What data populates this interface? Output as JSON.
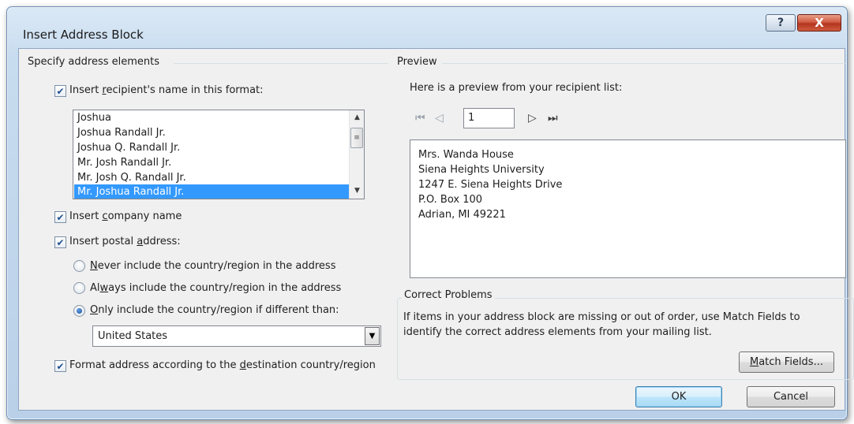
{
  "window": {
    "title": "Insert Address Block",
    "help_glyph": "?",
    "close_glyph": "X"
  },
  "left": {
    "group_title": "Specify address elements",
    "name_format": {
      "checked": true,
      "label_before": "Insert ",
      "label_accel": "r",
      "label_after": "ecipient's name in this format:",
      "items": [
        "Joshua",
        "Joshua Randall Jr.",
        "Joshua Q. Randall Jr.",
        "Mr. Josh Randall Jr.",
        "Mr. Josh Q. Randall Jr.",
        "Mr. Joshua Randall Jr."
      ],
      "selected_index": 5
    },
    "company": {
      "checked": true,
      "label_before": "Insert ",
      "label_accel": "c",
      "label_after": "ompany name"
    },
    "postal": {
      "checked": true,
      "label_before": "Insert postal ",
      "label_accel": "a",
      "label_after": "ddress:",
      "options": [
        {
          "before": "",
          "accel": "N",
          "after": "ever include the country/region in the address",
          "selected": false
        },
        {
          "before": "Al",
          "accel": "w",
          "after": "ays include the country/region in the address",
          "selected": false
        },
        {
          "before": "",
          "accel": "O",
          "after": "nly include the country/region if different than:",
          "selected": true
        }
      ],
      "country_value": "United States"
    },
    "format_by_destination": {
      "checked": true,
      "label_before": "Format address according to the ",
      "label_accel": "d",
      "label_after": "estination country/region"
    }
  },
  "right": {
    "preview_title": "Preview",
    "preview_intro": "Here is a preview from your recipient list:",
    "record_number": "1",
    "preview_lines": [
      "Mrs. Wanda House",
      "Siena Heights University",
      "1247 E. Siena Heights Drive",
      "P.O. Box 100",
      "Adrian, MI 49221"
    ],
    "correct_title": "Correct Problems",
    "correct_text_1": "If items in your address block are missing or out of order, use Match Fields to",
    "correct_text_2": "identify the correct address elements from your mailing list.",
    "match_accel": "M",
    "match_after": "atch Fields..."
  },
  "footer": {
    "ok_label": "OK",
    "cancel_label": "Cancel"
  },
  "icons": {
    "first": "⏮",
    "prev": "◁",
    "next": "▷",
    "last": "⏭",
    "check": "✔",
    "up": "▲",
    "down": "▼",
    "grip": "≡"
  }
}
